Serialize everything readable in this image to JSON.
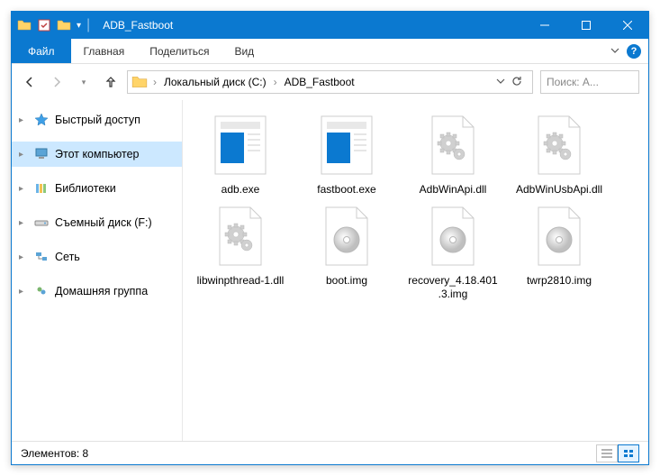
{
  "title": "ADB_Fastboot",
  "tabs": {
    "file": "Файл",
    "home": "Главная",
    "share": "Поделиться",
    "view": "Вид"
  },
  "breadcrumb": {
    "disk": "Локальный диск (C:)",
    "folder": "ADB_Fastboot"
  },
  "search_placeholder": "Поиск: A...",
  "sidebar": {
    "quick": "Быстрый доступ",
    "thispc": "Этот компьютер",
    "libs": "Библиотеки",
    "removable": "Съемный диск (F:)",
    "network": "Сеть",
    "homegroup": "Домашняя группа"
  },
  "files": [
    {
      "name": "adb.exe",
      "type": "exe"
    },
    {
      "name": "fastboot.exe",
      "type": "exe"
    },
    {
      "name": "AdbWinApi.dll",
      "type": "dll"
    },
    {
      "name": "AdbWinUsbApi.dll",
      "type": "dll"
    },
    {
      "name": "libwinpthread-1.dll",
      "type": "dll"
    },
    {
      "name": "boot.img",
      "type": "img"
    },
    {
      "name": "recovery_4.18.401.3.img",
      "type": "img"
    },
    {
      "name": "twrp2810.img",
      "type": "img"
    }
  ],
  "statusbar": "Элементов: 8"
}
